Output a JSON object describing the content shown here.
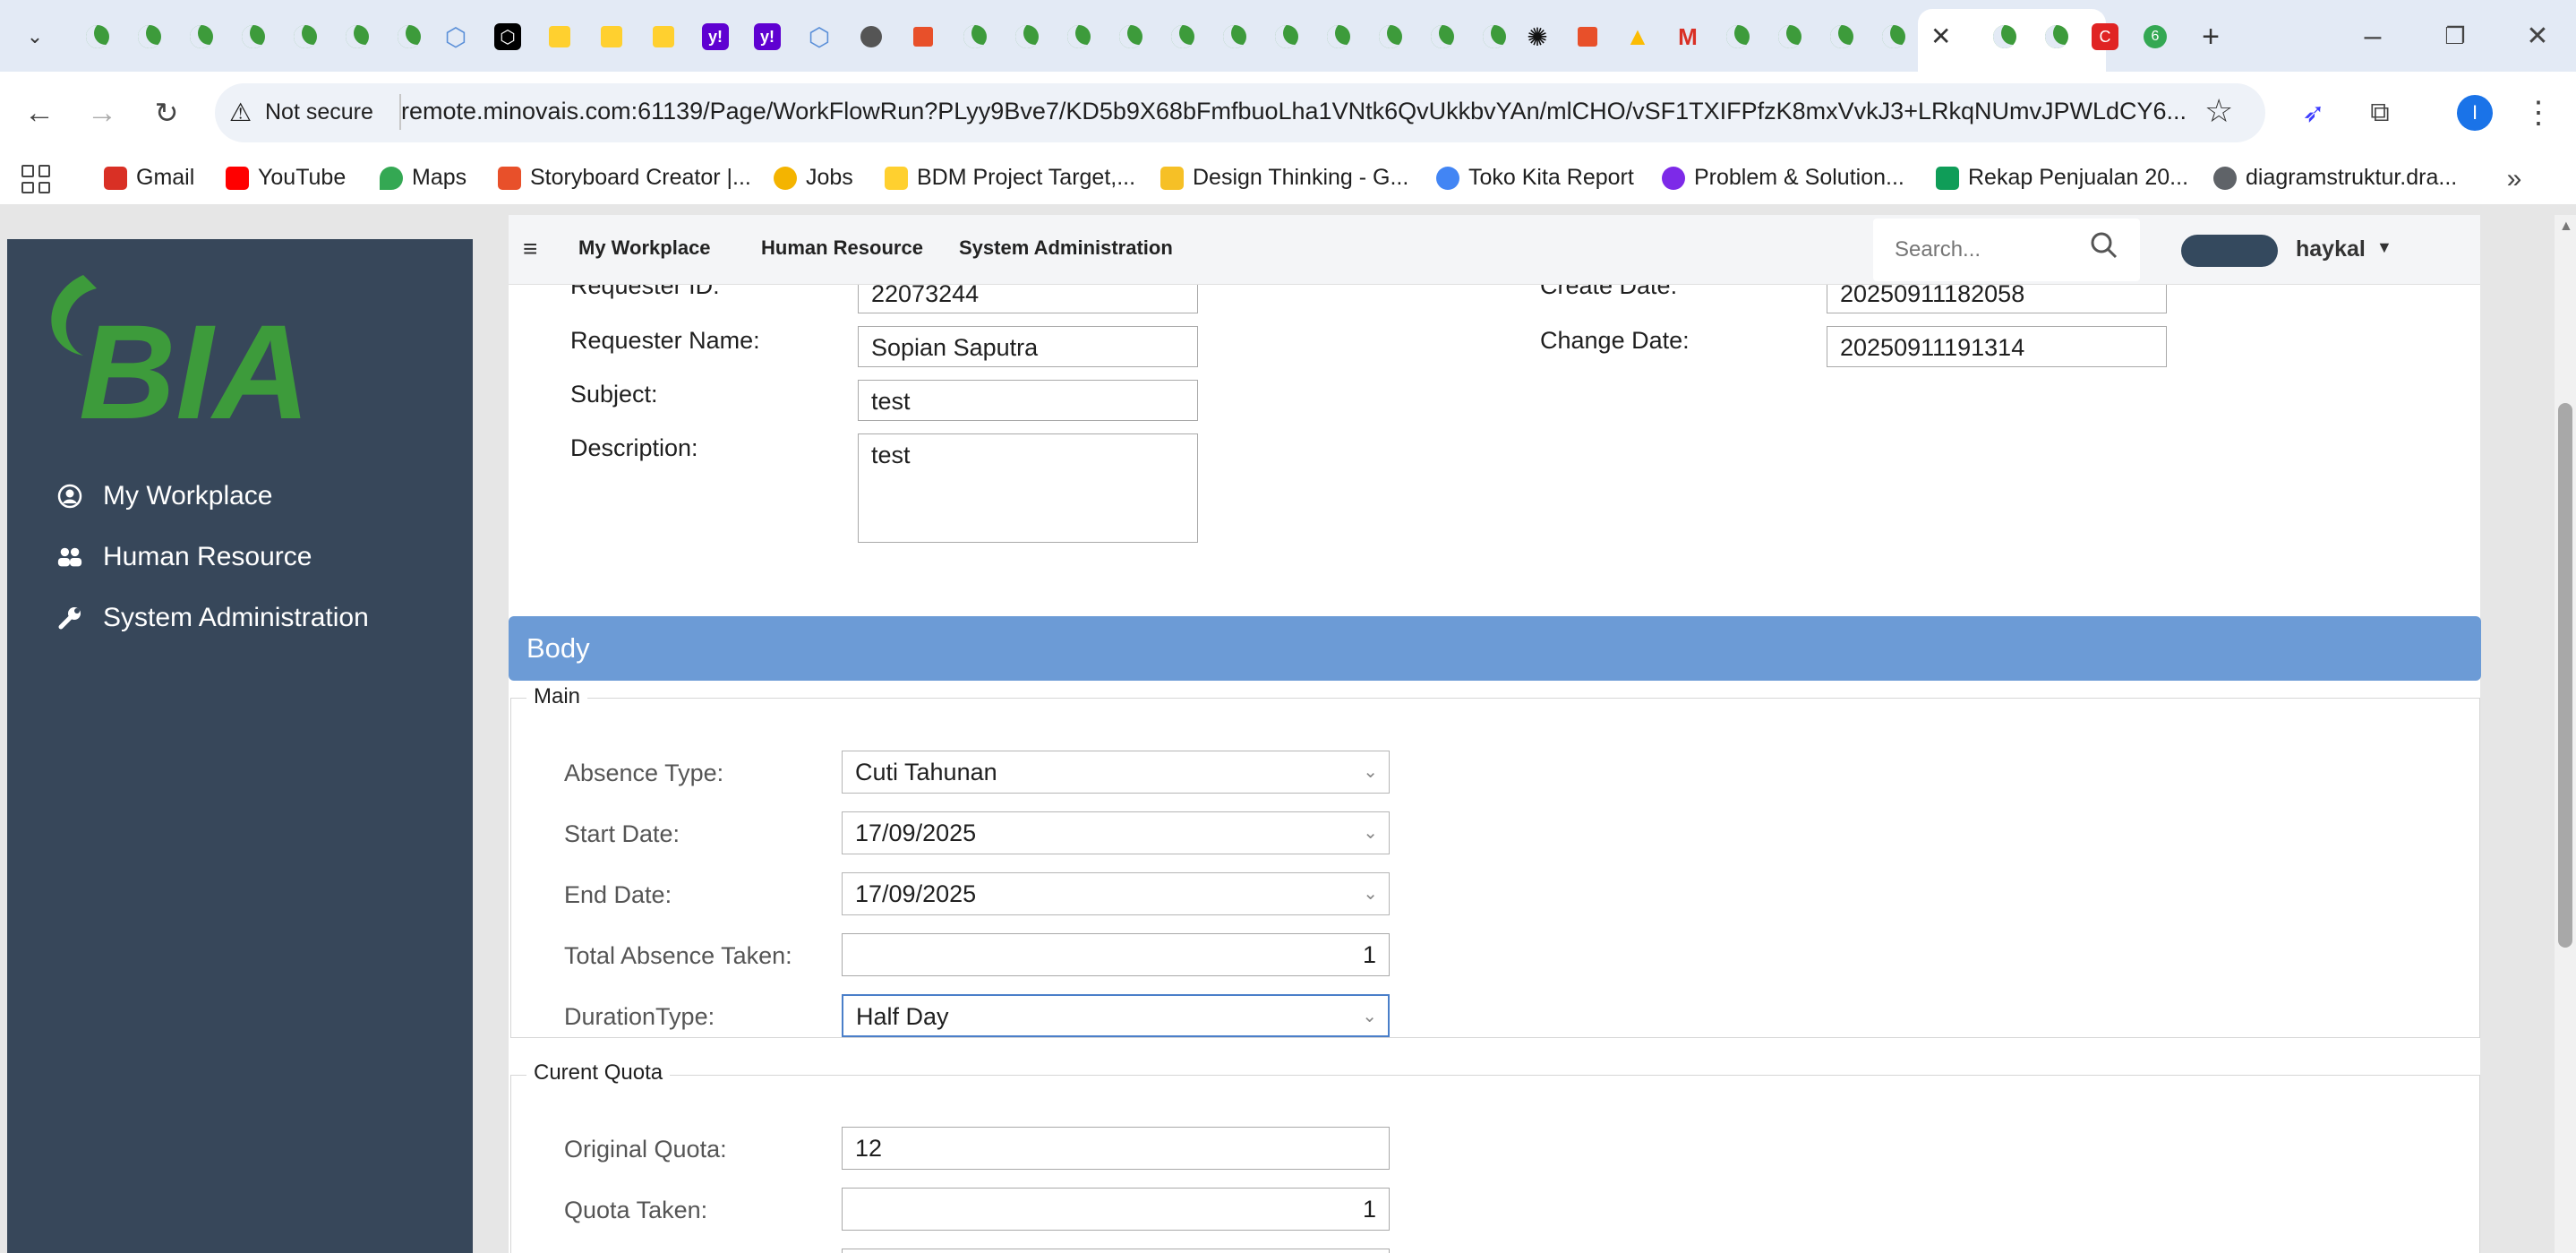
{
  "browser": {
    "url": "remote.minovais.com:61139/Page/WorkFlowRun?PLyy9Bve7/KD5b9X68bFmfbuoLha1VNtk6QvUkkbvYAn/mlCHO/vSF1TXIFPfzK8mxVvkJ3+LRkqNUmvJPWLdCY6...",
    "security_label": "Not secure",
    "profile_initial": "I",
    "tab_badge_count": "6",
    "bookmarks": [
      {
        "label": "Gmail",
        "icon": "gmail-icon",
        "color": "#d93025"
      },
      {
        "label": "YouTube",
        "icon": "youtube-icon",
        "color": "#ff0000"
      },
      {
        "label": "Maps",
        "icon": "maps-icon",
        "color": "#34a853"
      },
      {
        "label": "Storyboard Creator |...",
        "icon": "storyboard-icon",
        "color": "#e8502a"
      },
      {
        "label": "Jobs",
        "icon": "jobs-icon",
        "color": "#f4b400"
      },
      {
        "label": "BDM Project Target,...",
        "icon": "miro-icon",
        "color": "#ffd02f"
      },
      {
        "label": "Design Thinking - G...",
        "icon": "folder-icon",
        "color": "#f6c026"
      },
      {
        "label": "Toko Kita Report",
        "icon": "looker-icon",
        "color": "#4285f4"
      },
      {
        "label": "Problem & Solution...",
        "icon": "canva-icon",
        "color": "#7d2ae8"
      },
      {
        "label": "Rekap Penjualan 20...",
        "icon": "sheets-icon",
        "color": "#0f9d58"
      },
      {
        "label": "diagramstruktur.dra...",
        "icon": "drawio-icon",
        "color": "#5f6368"
      }
    ]
  },
  "app": {
    "logo_text": "BIA",
    "nav": [
      {
        "label": "My Workplace",
        "icon": "user-circle-icon"
      },
      {
        "label": "Human Resource",
        "icon": "users-icon"
      },
      {
        "label": "System Administration",
        "icon": "wrench-icon"
      }
    ],
    "topnav": [
      "My Workplace",
      "Human Resource",
      "System Administration"
    ],
    "search_placeholder": "Search...",
    "username": "haykal"
  },
  "header_form": {
    "requester_id_label": "Requester ID:",
    "requester_id": "22073244",
    "requester_name_label": "Requester Name:",
    "requester_name": "Sopian Saputra",
    "subject_label": "Subject:",
    "subject": "test",
    "description_label": "Description:",
    "description": "test",
    "create_date_label": "Create Date:",
    "create_date": "20250911182058",
    "change_date_label": "Change Date:",
    "change_date": "20250911191314"
  },
  "body": {
    "title": "Body",
    "main_legend": "Main",
    "absence_type_label": "Absence Type:",
    "absence_type": "Cuti Tahunan",
    "start_date_label": "Start Date:",
    "start_date": "17/09/2025",
    "end_date_label": "End Date:",
    "end_date": "17/09/2025",
    "total_absence_label": "Total Absence Taken:",
    "total_absence": "1",
    "duration_type_label": "DurationType:",
    "duration_type": "Half Day",
    "quota_legend": "Curent Quota",
    "original_quota_label": "Original Quota:",
    "original_quota": "12",
    "quota_taken_label": "Quota Taken:",
    "quota_taken": "1"
  },
  "colors": {
    "sidebar": "#37475a",
    "body_header": "#6c9bd6",
    "logo_green": "#3d9b3b"
  }
}
